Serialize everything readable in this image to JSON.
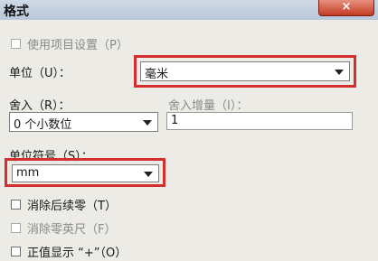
{
  "dialog": {
    "title": "格式",
    "close_glyph": "×"
  },
  "use_project_settings": {
    "label": "使用项目设置（P）"
  },
  "unit": {
    "label": "单位（U）：",
    "value": "毫米"
  },
  "rounding": {
    "label": "舍入（R）：",
    "value": "0 个小数位"
  },
  "rounding_increment": {
    "label": "舍入增量（I）：",
    "value": "1"
  },
  "unit_symbol": {
    "label": "单位符号（S）：",
    "value": "mm"
  },
  "options": [
    {
      "label": "消除后续零（T）",
      "enabled": true
    },
    {
      "label": "消除零英尺（F）",
      "enabled": false
    },
    {
      "label": "正值显示 “+”（O）",
      "enabled": true
    }
  ],
  "highlight_color": "#d32f2f"
}
